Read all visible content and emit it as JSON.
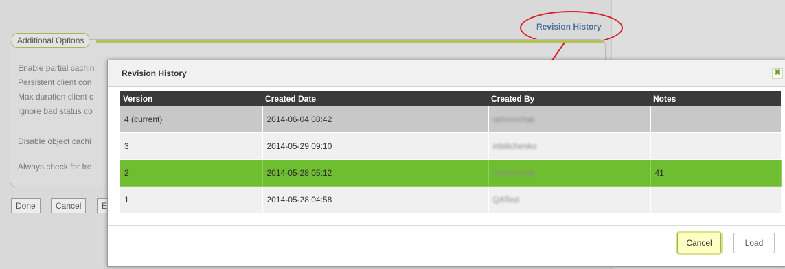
{
  "header": {
    "revision_link": "Revision History"
  },
  "options_panel": {
    "legend": "Additional Options",
    "labels": [
      "Enable partial cachin",
      "Persistent client con",
      "Max duration client c",
      "Ignore bad status co",
      "Disable object cachi",
      "Always check for fre"
    ],
    "buttons": {
      "done": "Done",
      "cancel": "Cancel",
      "partial": "E"
    }
  },
  "dialog": {
    "title": "Revision History",
    "close_glyph": "✖",
    "columns": [
      "Version",
      "Created Date",
      "Created By",
      "Notes"
    ],
    "rows": [
      {
        "version": "4 (current)",
        "created_date": "2014-06-04 08:42",
        "created_by": "okhomchak",
        "notes": "",
        "state": "current"
      },
      {
        "version": "3",
        "created_date": "2014-05-29 09:10",
        "created_by": "mbilichenko",
        "notes": "",
        "state": "normal"
      },
      {
        "version": "2",
        "created_date": "2014-05-28 05:12",
        "created_by": "okhomchak",
        "notes": "41",
        "state": "selected"
      },
      {
        "version": "1",
        "created_date": "2014-05-28 04:58",
        "created_by": "QATest",
        "notes": "",
        "state": "normal"
      }
    ],
    "buttons": {
      "cancel": "Cancel",
      "load": "Load"
    }
  },
  "colors": {
    "header_bg": "#3a3a3a",
    "selected_row": "#6fbe31",
    "annotation_red": "#d62027",
    "accent_olive": "#b9c25a"
  }
}
